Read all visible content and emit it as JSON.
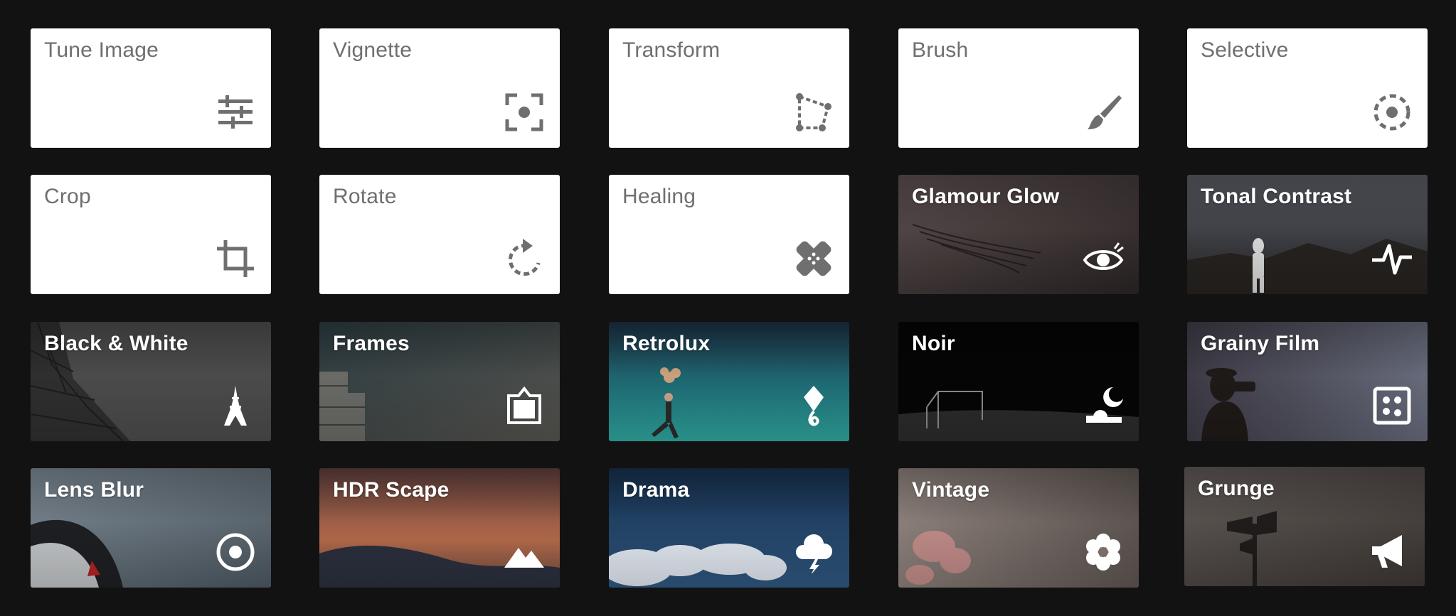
{
  "tools": [
    {
      "label": "Tune Image",
      "icon": "sliders-icon"
    },
    {
      "label": "Vignette",
      "icon": "vignette-icon"
    },
    {
      "label": "Transform",
      "icon": "transform-icon"
    },
    {
      "label": "Brush",
      "icon": "brush-icon"
    },
    {
      "label": "Selective",
      "icon": "selective-icon"
    },
    {
      "label": "Crop",
      "icon": "crop-icon"
    },
    {
      "label": "Rotate",
      "icon": "rotate-icon"
    },
    {
      "label": "Healing",
      "icon": "bandage-icon"
    }
  ],
  "filters": [
    {
      "label": "Glamour Glow",
      "icon": "eye-icon"
    },
    {
      "label": "Tonal Contrast",
      "icon": "pulse-icon"
    },
    {
      "label": "Black & White",
      "icon": "eiffel-tower-icon"
    },
    {
      "label": "Frames",
      "icon": "frame-icon"
    },
    {
      "label": "Retrolux",
      "icon": "kite-icon"
    },
    {
      "label": "Noir",
      "icon": "moon-icon"
    },
    {
      "label": "Grainy Film",
      "icon": "dice-icon"
    },
    {
      "label": "Lens Blur",
      "icon": "target-icon"
    },
    {
      "label": "HDR Scape",
      "icon": "mountains-icon"
    },
    {
      "label": "Drama",
      "icon": "storm-cloud-icon"
    },
    {
      "label": "Vintage",
      "icon": "flower-icon"
    },
    {
      "label": "Grunge",
      "icon": "megaphone-icon"
    }
  ],
  "colors": {
    "background": "#121212",
    "tool_tile": "#ffffff",
    "tool_text": "#6f6f6f",
    "filter_text": "#ffffff"
  }
}
